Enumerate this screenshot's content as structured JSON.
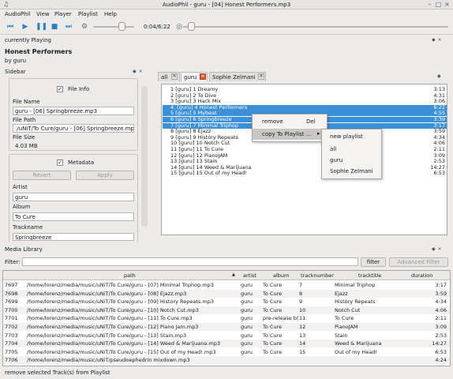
{
  "window": {
    "title": "AudioPhil - guru - [04] Honest Performers.mp3"
  },
  "menu": [
    "AudioPhil",
    "View",
    "Player",
    "Playlist",
    "Help"
  ],
  "player": {
    "time": "0:04/6:22",
    "volume_fraction": 0.7,
    "seek_fraction": 0.03
  },
  "now_playing": {
    "header": "currently Playing",
    "title": "Honest Performers",
    "artist": "by guru"
  },
  "sidebar": {
    "header": "Sidebar",
    "file_info": {
      "label": "File Info",
      "checked": true,
      "file_name_label": "File Name",
      "file_name": "guru - [06] Springbreeze.mp3",
      "file_path_label": "File Path",
      "file_path": ":/uNiT/To Cure/guru - [06] Springbreeze.mp3",
      "file_size_label": "File Size",
      "file_size": "4.03 MB"
    },
    "metadata": {
      "label": "Metadata",
      "checked": true,
      "revert": "Revert",
      "apply": "Apply",
      "artist_label": "Artist",
      "artist": "guru",
      "album_label": "Album",
      "album": "To Cure",
      "trackname_label": "Trackname",
      "trackname": "Springbreeze"
    }
  },
  "playlist_tabs": [
    {
      "label": "all"
    },
    {
      "label": "guru"
    },
    {
      "label": "Sophie Zelmani"
    }
  ],
  "playlist": [
    {
      "label": "1 [guru] 1 Dreamy",
      "duration": "3:13",
      "selected": false
    },
    {
      "label": "2 [guru] 2 To Dive",
      "duration": "4:31",
      "selected": false
    },
    {
      "label": "3 [guru] 3 Hack Mix",
      "duration": "3:06",
      "selected": false
    },
    {
      "label": "4. [guru] 4 Honest Performers",
      "duration": "6:22",
      "selected": true
    },
    {
      "label": "5 [guru] 5 Mybeat",
      "duration": "4:55",
      "selected": true
    },
    {
      "label": "6 [guru] 6 Springbreeze",
      "duration": "3:39",
      "selected": true
    },
    {
      "label": "7 [guru] 7 Minimal Triphop",
      "duration": "3:17",
      "selected": true
    },
    {
      "label": "8 [guru] 8 Ejazz",
      "duration": "3:59",
      "selected": false
    },
    {
      "label": "9 [guru] 9 History Repeats",
      "duration": "4:34",
      "selected": false
    },
    {
      "label": "10 [guru] 10 Notch Cut",
      "duration": "4:06",
      "selected": false
    },
    {
      "label": "11 [guru] 11 To Cure",
      "duration": "2:11",
      "selected": false
    },
    {
      "label": "12 [guru] 12 PianoJAM",
      "duration": "3:09",
      "selected": false
    },
    {
      "label": "13 [guru] 13 Stain",
      "duration": "2:53",
      "selected": false
    },
    {
      "label": "14 [guru] 14 Weed & Marijuana",
      "duration": "14:27",
      "selected": false
    },
    {
      "label": "15 [guru] 15 Out of my Head!",
      "duration": "6:53",
      "selected": false
    }
  ],
  "context_menu": {
    "remove": "remove",
    "remove_shortcut": "Del",
    "copy": "copy To Playlist ..."
  },
  "submenu": [
    "new playlist",
    "all",
    "guru",
    "Sophie Zelmani"
  ],
  "media_library": {
    "header": "Media Library",
    "filter_label": "Filter:",
    "filter_value": "",
    "filter_button": "filter",
    "advanced_button": "Advanced Filter",
    "columns": [
      "path",
      "artist",
      "album",
      "tracknumber",
      "tracktitle",
      "duration"
    ],
    "rows": [
      {
        "id": "7697",
        "path": "/home/lorenz/media/music/uNiT/To Cure/guru - [07] Minimal Triphop.mp3",
        "artist": "guru",
        "album": "To Cure",
        "track": "7",
        "title": "Minimal Triphop",
        "duration": "3:17"
      },
      {
        "id": "7698",
        "path": "/home/lorenz/media/music/uNiT/To Cure/guru - [08] Ejazz.mp3",
        "artist": "guru",
        "album": "To Cure",
        "track": "8",
        "title": "Ejazz",
        "duration": "3:59"
      },
      {
        "id": "7699",
        "path": "/home/lorenz/media/music/uNiT/To Cure/guru - [09] History Repeats.mp3",
        "artist": "guru",
        "album": "To Cure",
        "track": "9",
        "title": "History Repeats",
        "duration": "4:34"
      },
      {
        "id": "7700",
        "path": "/home/lorenz/media/music/uNiT/To Cure/guru - [10] Notch Cut.mp3",
        "artist": "guru",
        "album": "To Cure",
        "track": "10",
        "title": "Notch Cut",
        "duration": "4:06"
      },
      {
        "id": "7701",
        "path": "/home/lorenz/media/music/uNiT/To Cure/guru - [11] To Cure.mp3",
        "artist": "guru",
        "album": "pre-release b(",
        "track": "11",
        "title": "To Cure",
        "duration": "2:11"
      },
      {
        "id": "7702",
        "path": "/home/lorenz/media/music/uNiT/To Cure/guru - [12] Piano Jam.mp3",
        "artist": "guru",
        "album": "To Cure",
        "track": "12",
        "title": "PianoJAM",
        "duration": "3:09"
      },
      {
        "id": "7703",
        "path": "/home/lorenz/media/music/uNiT/To Cure/guru - [13] Stain.mp3",
        "artist": "guru",
        "album": "To Cure",
        "track": "13",
        "title": "Stain",
        "duration": "2:53"
      },
      {
        "id": "7704",
        "path": "/home/lorenz/media/music/uNiT/To Cure/guru - [14] Weed & Marijuana.mp3",
        "artist": "guru",
        "album": "To Cure",
        "track": "14",
        "title": "Weed & Marijuana",
        "duration": "14:27"
      },
      {
        "id": "7705",
        "path": "/home/lorenz/media/music/uNiT/To Cure/guru - [15] Out of my Head!.mp3",
        "artist": "guru",
        "album": "To Cure",
        "track": "15",
        "title": "Out of my Head!",
        "duration": "6:53"
      },
      {
        "id": "7706",
        "path": "/home/lorenz/media/music/uNiT/pseudoephedrin mixdown.mp3",
        "artist": "",
        "album": "",
        "track": "",
        "title": "",
        "duration": "4:24"
      }
    ]
  },
  "status": "remove selected Track(s) from Playlist",
  "colors": {
    "selection": "#3d8fd6",
    "accent_icons": "#2a7fc0"
  },
  "icons": [
    "app-icon",
    "previous-icon",
    "play-icon",
    "pause-icon",
    "stop-icon",
    "next-icon",
    "volume-icon",
    "seek-icon"
  ]
}
